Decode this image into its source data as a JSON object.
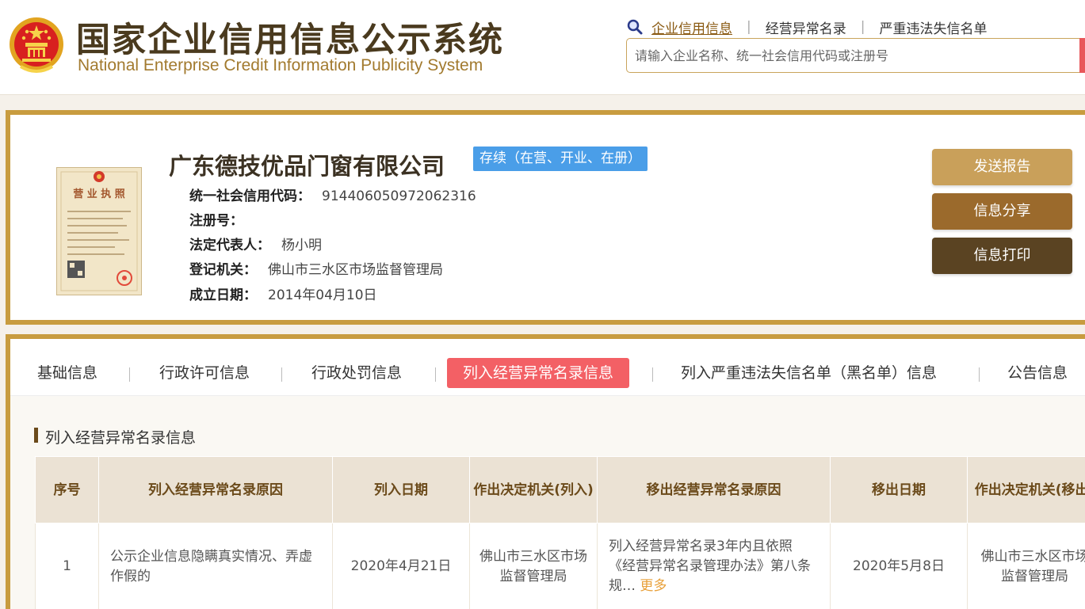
{
  "header": {
    "title_cn": "国家企业信用信息公示系统",
    "title_en": "National Enterprise Credit Information Publicity System",
    "search_tabs": [
      "企业信用信息",
      "经营异常名录",
      "严重违法失信名单"
    ],
    "search_placeholder": "请输入企业名称、统一社会信用代码或注册号"
  },
  "company": {
    "name": "广东德技优品门窗有限公司",
    "status": "存续（在营、开业、在册）",
    "license_label": "营业执照",
    "fields": [
      {
        "label": "统一社会信用代码：",
        "value": "914406050972062316"
      },
      {
        "label": "注册号：",
        "value": ""
      },
      {
        "label": "法定代表人：",
        "value": "杨小明"
      },
      {
        "label": "登记机关：",
        "value": "佛山市三水区市场监督管理局"
      },
      {
        "label": "成立日期：",
        "value": "2014年04月10日"
      }
    ]
  },
  "actions": {
    "send_report": "发送报告",
    "share": "信息分享",
    "print": "信息打印"
  },
  "tabs": [
    {
      "label": "基础信息",
      "active": false
    },
    {
      "label": "行政许可信息",
      "active": false
    },
    {
      "label": "行政处罚信息",
      "active": false
    },
    {
      "label": "列入经营异常名录信息",
      "active": true
    },
    {
      "label": "列入严重违法失信名单（黑名单）信息",
      "active": false
    },
    {
      "label": "公告信息",
      "active": false
    }
  ],
  "section": {
    "title": "列入经营异常名录信息",
    "columns": [
      "序号",
      "列入经营异常名录原因",
      "列入日期",
      "作出决定机关(列入)",
      "移出经营异常名录原因",
      "移出日期",
      "作出决定机关(移出)"
    ],
    "rows": [
      {
        "index": "1",
        "reason": "公示企业信息隐瞒真实情况、弄虚作假的",
        "date_in": "2020年4月21日",
        "authority_in": "佛山市三水区市场监督管理局",
        "remove_reason": "列入经营异常名录3年内且依照《经营异常名录管理办法》第八条规…",
        "more": "更多",
        "date_out": "2020年5月8日",
        "authority_out": "佛山市三水区市场监督管理局"
      }
    ]
  },
  "colors": {
    "brand_gold": "#c89c3f",
    "active_tab": "#f36065",
    "status_blue": "#4a9ee8",
    "btn_send": "#c9a05a",
    "btn_share": "#9b6a2c",
    "btn_print": "#5a4322"
  }
}
